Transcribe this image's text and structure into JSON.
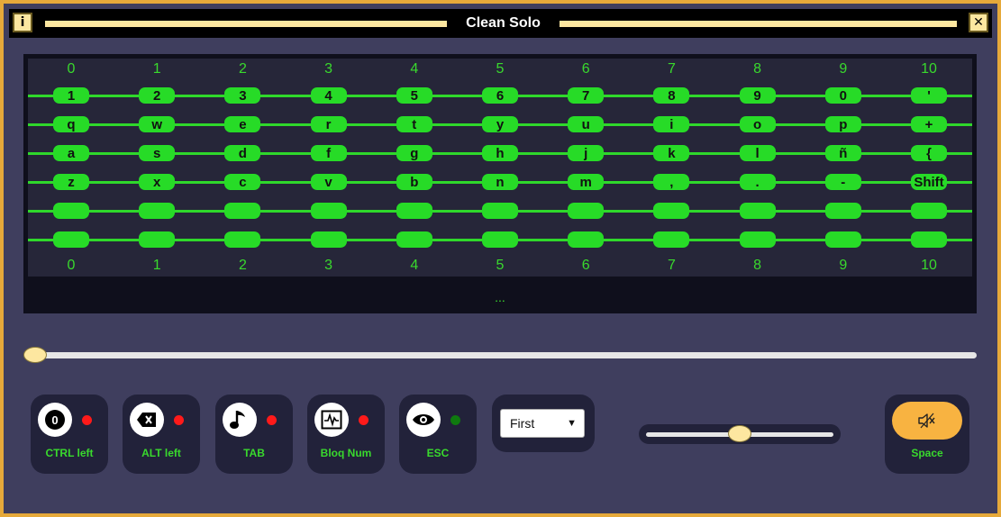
{
  "window": {
    "title": "Clean Solo",
    "info_label": "i",
    "close_label": "✕"
  },
  "fretboard": {
    "fret_numbers": [
      "0",
      "1",
      "2",
      "3",
      "4",
      "5",
      "6",
      "7",
      "8",
      "9",
      "10"
    ],
    "rows": [
      [
        "1",
        "2",
        "3",
        "4",
        "5",
        "6",
        "7",
        "8",
        "9",
        "0",
        "'"
      ],
      [
        "q",
        "w",
        "e",
        "r",
        "t",
        "y",
        "u",
        "i",
        "o",
        "p",
        "+"
      ],
      [
        "a",
        "s",
        "d",
        "f",
        "g",
        "h",
        "j",
        "k",
        "l",
        "ñ",
        "{"
      ],
      [
        "z",
        "x",
        "c",
        "v",
        "b",
        "n",
        "m",
        ",",
        ".",
        "-",
        "Shift"
      ],
      [
        "",
        "",
        "",
        "",
        "",
        "",
        "",
        "",
        "",
        "",
        ""
      ],
      [
        "",
        "",
        "",
        "",
        "",
        "",
        "",
        "",
        "",
        "",
        ""
      ]
    ],
    "status": "..."
  },
  "progress": {
    "value": 0
  },
  "controls": [
    {
      "label": "CTRL left",
      "icon": "zero-badge-icon",
      "glyph": "0",
      "indicator": "#ff1a1a"
    },
    {
      "label": "ALT left",
      "icon": "backspace-icon",
      "indicator": "#ff1a1a"
    },
    {
      "label": "TAB",
      "icon": "music-note-icon",
      "indicator": "#ff1a1a"
    },
    {
      "label": "Bloq Num",
      "icon": "waveform-icon",
      "indicator": "#ff1a1a"
    },
    {
      "label": "ESC",
      "icon": "eye-icon",
      "indicator": "#0f7a0f"
    }
  ],
  "mode_select": {
    "selected": "First"
  },
  "volume": {
    "value": 0.5
  },
  "space_button": {
    "label": "Space",
    "icon": "mute-speaker-icon"
  },
  "colors": {
    "accent": "#27db27",
    "frame": "#e6a93a",
    "thumb": "#fde7a0",
    "space_button": "#f8b341"
  }
}
